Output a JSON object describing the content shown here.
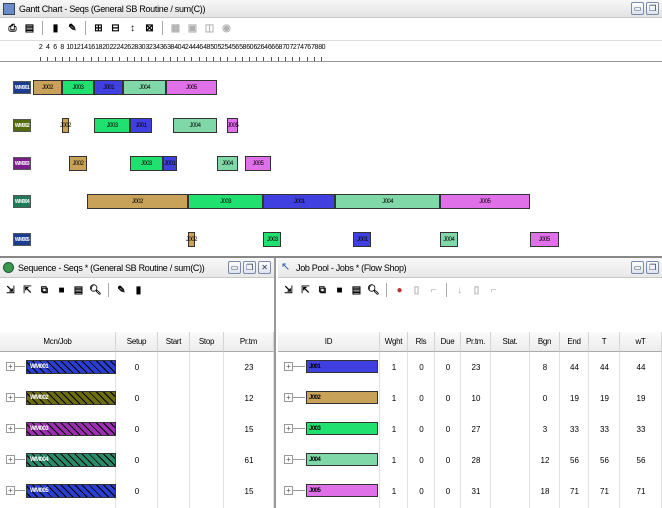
{
  "gantt": {
    "title": "Gantt Chart - Seqs (General SB Routine / sum(C))",
    "ticks": [
      "2",
      "4",
      "6",
      "8",
      "10",
      "12",
      "14",
      "16",
      "18",
      "20",
      "22",
      "24",
      "26",
      "28",
      "30",
      "32",
      "34",
      "36",
      "38",
      "40",
      "42",
      "44",
      "46",
      "48",
      "50",
      "52",
      "54",
      "56",
      "58",
      "60",
      "62",
      "64",
      "66",
      "68",
      "70",
      "72",
      "74",
      "76",
      "78",
      "80"
    ],
    "rows": [
      {
        "label": "WM001",
        "color": "#1a3d8f",
        "bars": [
          {
            "label": "J002",
            "start": 0,
            "end": 8,
            "color": "#c9a25a"
          },
          {
            "label": "J003",
            "start": 8,
            "end": 17,
            "color": "#20e070"
          },
          {
            "label": "J001",
            "start": 17,
            "end": 25,
            "color": "#4040e0"
          },
          {
            "label": "J004",
            "start": 25,
            "end": 37,
            "color": "#80d8a8"
          },
          {
            "label": "J005",
            "start": 37,
            "end": 51,
            "color": "#e070e8"
          }
        ]
      },
      {
        "label": "WM002",
        "color": "#556b10",
        "bars": [
          {
            "label": "J002",
            "start": 8,
            "end": 10,
            "color": "#c9a25a"
          },
          {
            "label": "J003",
            "start": 17,
            "end": 27,
            "color": "#20e070"
          },
          {
            "label": "J001",
            "start": 27,
            "end": 33,
            "color": "#4040e0"
          },
          {
            "label": "J004",
            "start": 39,
            "end": 51,
            "color": "#80d8a8"
          },
          {
            "label": "J005",
            "start": 54,
            "end": 57,
            "color": "#e070e8"
          }
        ]
      },
      {
        "label": "WM003",
        "color": "#7a1f8a",
        "bars": [
          {
            "label": "J002",
            "start": 10,
            "end": 15,
            "color": "#c9a25a"
          },
          {
            "label": "J003",
            "start": 27,
            "end": 36,
            "color": "#20e070"
          },
          {
            "label": "J001",
            "start": 36,
            "end": 40,
            "color": "#4040e0"
          },
          {
            "label": "J004",
            "start": 51,
            "end": 57,
            "color": "#80d8a8"
          },
          {
            "label": "J005",
            "start": 59,
            "end": 66,
            "color": "#e070e8"
          }
        ]
      },
      {
        "label": "WM004",
        "color": "#1f7a5a",
        "bars": [
          {
            "label": "J002",
            "start": 15,
            "end": 43,
            "color": "#c9a25a"
          },
          {
            "label": "J003",
            "start": 43,
            "end": 64,
            "color": "#20e070"
          },
          {
            "label": "J001",
            "start": 64,
            "end": 84,
            "color": "#4040e0"
          },
          {
            "label": "J004",
            "start": 84,
            "end": 113,
            "color": "#80d8a8"
          },
          {
            "label": "J005",
            "start": 113,
            "end": 138,
            "color": "#e070e8"
          }
        ]
      },
      {
        "label": "WM005",
        "color": "#1a3d8f",
        "bars": [
          {
            "label": "J002",
            "start": 43,
            "end": 45,
            "color": "#c9a25a"
          },
          {
            "label": "J003",
            "start": 64,
            "end": 69,
            "color": "#20e070"
          },
          {
            "label": "J001",
            "start": 89,
            "end": 94,
            "color": "#4040e0"
          },
          {
            "label": "J004",
            "start": 113,
            "end": 118,
            "color": "#80d8a8"
          },
          {
            "label": "J005",
            "start": 138,
            "end": 146,
            "color": "#e070e8"
          }
        ]
      }
    ]
  },
  "sequence": {
    "title": "Sequence - Seqs * (General SB Routine / sum(C))",
    "columns": [
      "Mcn/Job",
      "Setup",
      "Start",
      "Stop",
      "Pr.tm"
    ],
    "rows": [
      {
        "label": "WM001",
        "color": "#2a3fd0",
        "setup": "0",
        "start": "",
        "stop": "",
        "prtm": "23"
      },
      {
        "label": "WM002",
        "color": "#6b6b10",
        "setup": "0",
        "start": "",
        "stop": "",
        "prtm": "12"
      },
      {
        "label": "WM003",
        "color": "#9a2fb0",
        "setup": "0",
        "start": "",
        "stop": "",
        "prtm": "15"
      },
      {
        "label": "WM004",
        "color": "#2a8a68",
        "setup": "0",
        "start": "",
        "stop": "",
        "prtm": "61"
      },
      {
        "label": "WM005",
        "color": "#2a3fd0",
        "setup": "0",
        "start": "",
        "stop": "",
        "prtm": "15"
      }
    ]
  },
  "jobpool": {
    "title": "Job Pool - Jobs * (Flow Shop)",
    "columns": [
      "ID",
      "Wght",
      "Rls",
      "Due",
      "Pr.tm.",
      "Stat.",
      "Bgn",
      "End",
      "T",
      "wT"
    ],
    "rows": [
      {
        "id": "J001",
        "color": "#4040e0",
        "wght": "1",
        "rls": "0",
        "due": "0",
        "prtm": "23",
        "stat": "",
        "bgn": "8",
        "end": "44",
        "t": "44",
        "wt": "44"
      },
      {
        "id": "J002",
        "color": "#c9a25a",
        "wght": "1",
        "rls": "0",
        "due": "0",
        "prtm": "10",
        "stat": "",
        "bgn": "0",
        "end": "19",
        "t": "19",
        "wt": "19"
      },
      {
        "id": "J003",
        "color": "#20e070",
        "wght": "1",
        "rls": "0",
        "due": "0",
        "prtm": "27",
        "stat": "",
        "bgn": "3",
        "end": "33",
        "t": "33",
        "wt": "33"
      },
      {
        "id": "J004",
        "color": "#80d8a8",
        "wght": "1",
        "rls": "0",
        "due": "0",
        "prtm": "28",
        "stat": "",
        "bgn": "12",
        "end": "56",
        "t": "56",
        "wt": "56"
      },
      {
        "id": "J005",
        "color": "#e070e8",
        "wght": "1",
        "rls": "0",
        "due": "0",
        "prtm": "31",
        "stat": "",
        "bgn": "18",
        "end": "71",
        "t": "71",
        "wt": "71"
      }
    ]
  }
}
